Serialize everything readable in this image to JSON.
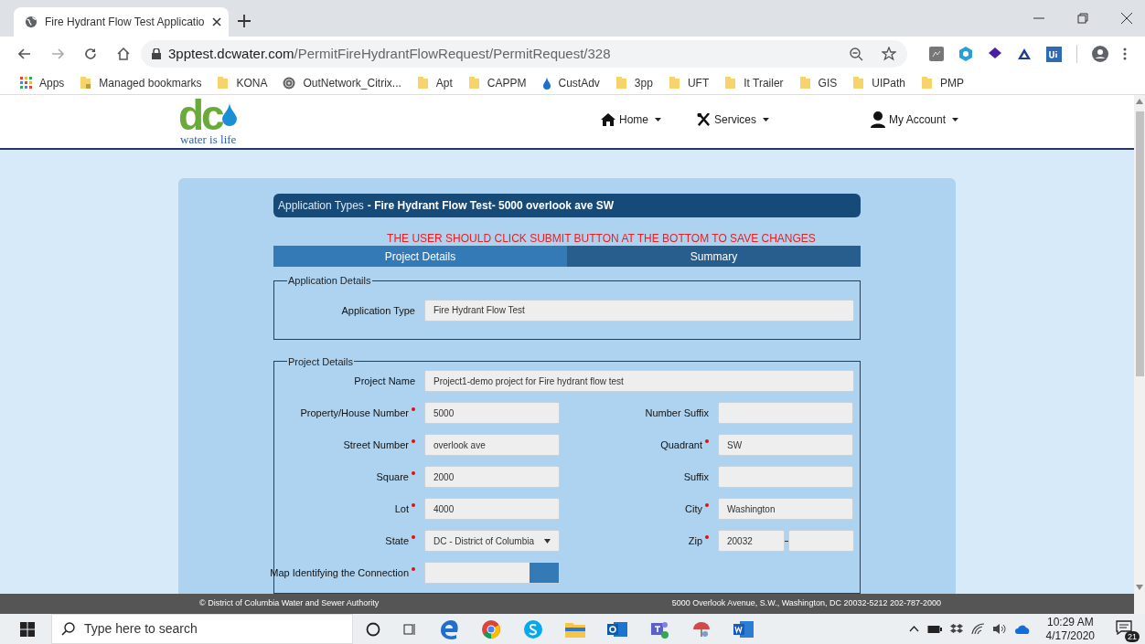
{
  "browser": {
    "tabs": [
      {
        "title": "Fire Hydrant Flow Test Applicatio",
        "selected": true
      }
    ],
    "url": {
      "host": "3pptest.dcwater.com",
      "path": "/PermitFireHydrantFlowRequest/PermitRequest/328"
    },
    "bookmarks": [
      {
        "label": "Apps",
        "kind": "apps"
      },
      {
        "label": "Managed bookmarks",
        "kind": "managed"
      },
      {
        "label": "KONA",
        "kind": "folder"
      },
      {
        "label": "OutNetwork_Citrix...",
        "kind": "citrix"
      },
      {
        "label": "Apt",
        "kind": "folder"
      },
      {
        "label": "CAPPM",
        "kind": "folder"
      },
      {
        "label": "CustAdv",
        "kind": "drop"
      },
      {
        "label": "3pp",
        "kind": "folder"
      },
      {
        "label": "UFT",
        "kind": "folder"
      },
      {
        "label": "It Trailer",
        "kind": "folder"
      },
      {
        "label": "GIS",
        "kind": "folder"
      },
      {
        "label": "UIPath",
        "kind": "folder"
      },
      {
        "label": "PMP",
        "kind": "folder"
      }
    ]
  },
  "site": {
    "logo": {
      "mark": "dc",
      "tagline": "water is life"
    },
    "nav": [
      {
        "label": "Home",
        "kind": "home"
      },
      {
        "label": "Services",
        "kind": "tools"
      },
      {
        "label": "My Account",
        "kind": "user"
      }
    ],
    "title_prefix": "Application Types",
    "title": "- Fire Hydrant Flow Test- 5000 overlook ave SW",
    "warning": "THE USER SHOULD CLICK SUBMIT BUTTON AT THE BOTTOM TO SAVE CHANGES",
    "tabs": [
      {
        "label": "Project Details",
        "selected": true
      },
      {
        "label": "Summary",
        "selected": false
      }
    ],
    "sections": [
      {
        "legend": "Application Details",
        "rows": [
          [
            {
              "label": "Application Type",
              "value": "Fire Hydrant Flow Test",
              "required": false,
              "kind": "wide"
            }
          ]
        ]
      },
      {
        "legend": "Project Details",
        "rows": [
          [
            {
              "label": "Project Name",
              "value": "Project1-demo project for Fire hydrant flow test",
              "required": false,
              "kind": "wide"
            }
          ],
          [
            {
              "label": "Property/House Number",
              "value": "5000",
              "required": true,
              "kind": "text"
            },
            {
              "label": "Number Suffix",
              "required": false,
              "kind": "text"
            }
          ],
          [
            {
              "label": "Street Number",
              "value": "overlook ave",
              "required": true,
              "kind": "text"
            },
            {
              "label": "Quadrant",
              "value": "SW",
              "required": true,
              "kind": "text"
            }
          ],
          [
            {
              "label": "Square",
              "value": "2000",
              "required": true,
              "kind": "text"
            },
            {
              "label": "Suffix",
              "required": false,
              "kind": "text"
            }
          ],
          [
            {
              "label": "Lot",
              "value": "4000",
              "required": true,
              "kind": "text"
            },
            {
              "label": "City",
              "value": "Washington",
              "required": true,
              "kind": "text"
            }
          ],
          [
            {
              "label": "State",
              "value": "DC - District of Columbia",
              "required": true,
              "kind": "select"
            },
            {
              "label": "Zip",
              "value": "20032",
              "required": true,
              "kind": "zip"
            }
          ],
          [
            {
              "label": "Map Identifying the Connection",
              "required": true,
              "kind": "file"
            }
          ]
        ]
      }
    ],
    "footer": {
      "left": "© District of Columbia Water and Sewer Authority",
      "right": "5000 Overlook Avenue, S.W., Washington, DC 20032-5212 202-787-2000"
    }
  },
  "taskbar": {
    "search_placeholder": "Type here to search",
    "time": "10:29 AM",
    "date": "4/17/2020",
    "notifications": "21"
  }
}
